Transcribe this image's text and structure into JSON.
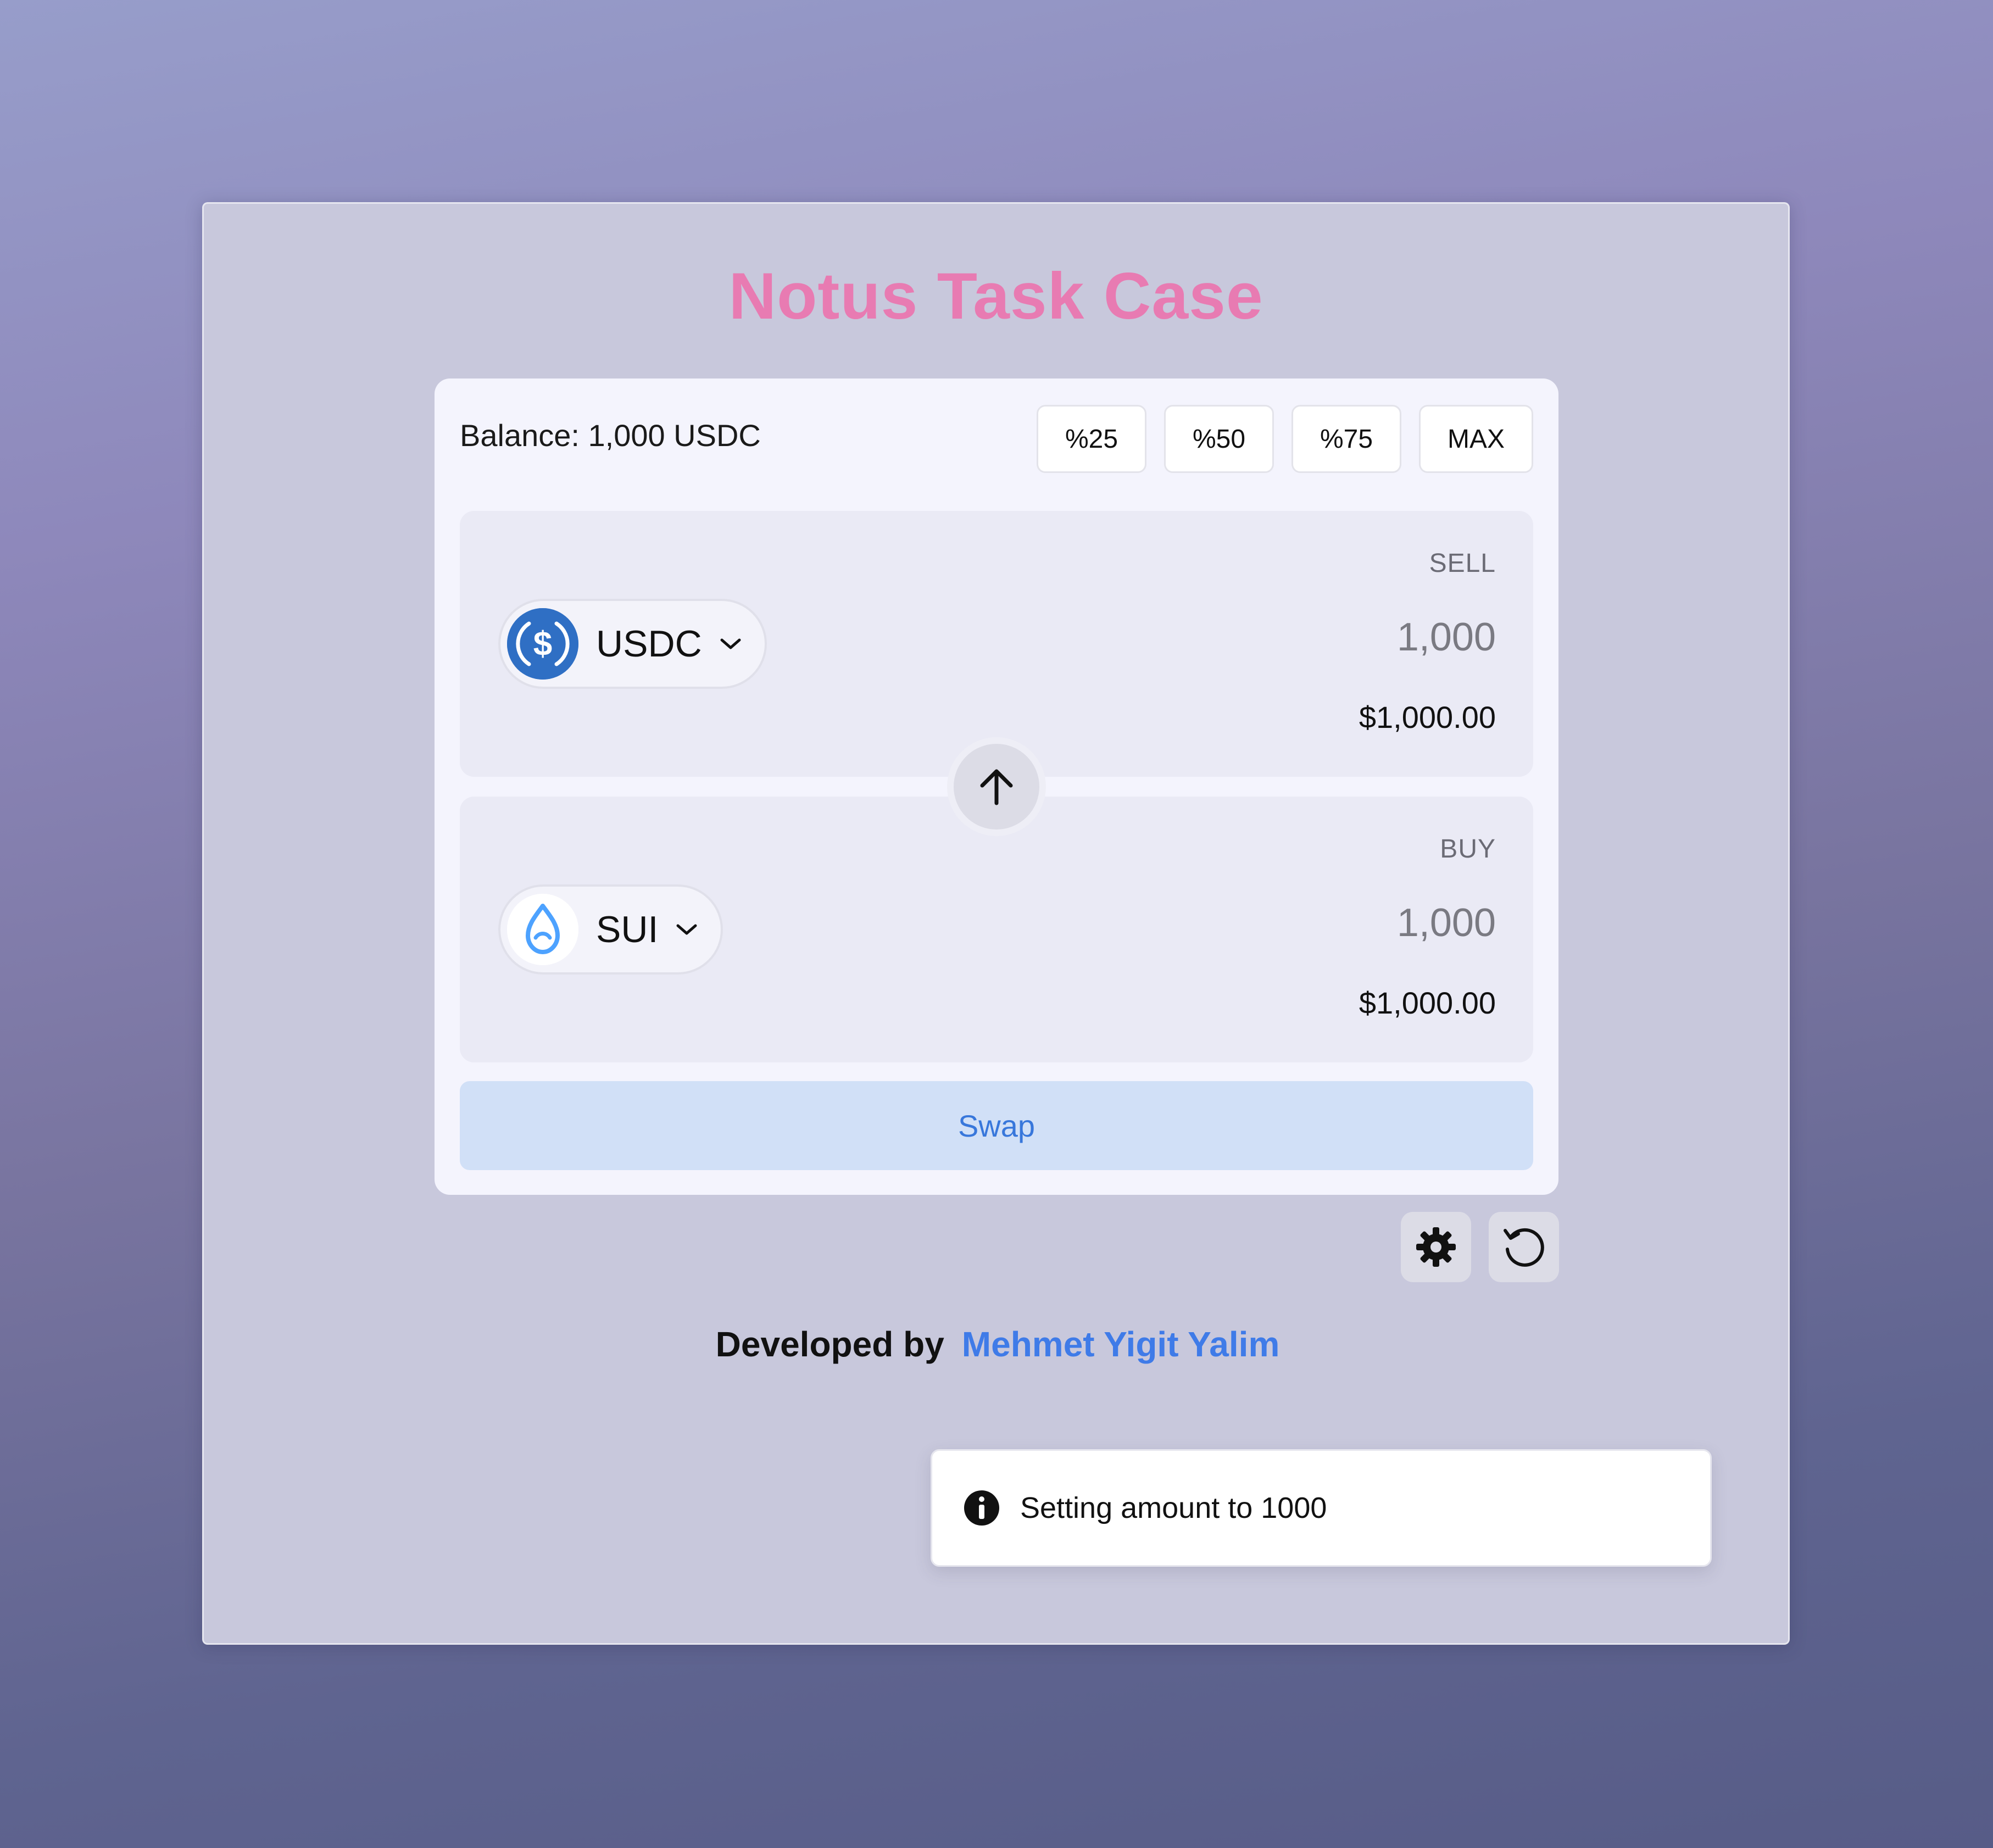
{
  "app": {
    "title": "Notus Task Case"
  },
  "balance": {
    "label": "Balance: 1,000 USDC"
  },
  "quick_amounts": [
    "%25",
    "%50",
    "%75",
    "MAX"
  ],
  "sell": {
    "label": "SELL",
    "token": "USDC",
    "token_icon": "usdc-icon",
    "amount": "1,000",
    "usd_value": "$1,000.00"
  },
  "buy": {
    "label": "BUY",
    "token": "SUI",
    "token_icon": "sui-icon",
    "amount": "1,000",
    "usd_value": "$1,000.00"
  },
  "swap_button": {
    "label": "Swap"
  },
  "footer": {
    "prefix": "Developed by",
    "author": "Mehmet Yigit Yalim"
  },
  "toast": {
    "message": "Setting amount to 1000"
  },
  "colors": {
    "title": "#e87bb2",
    "accent_blue": "#3f7be8",
    "swap_bg": "#d1e0f7",
    "usdc_blue": "#2775ca",
    "sui_blue": "#4da2ff"
  }
}
